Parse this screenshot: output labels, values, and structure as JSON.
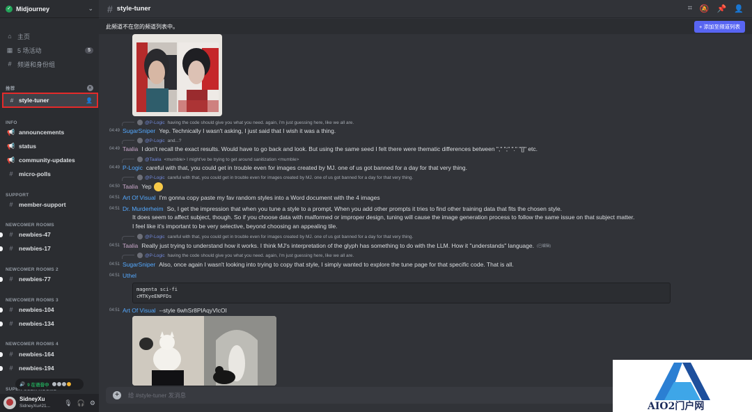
{
  "server": {
    "name": "Midjourney"
  },
  "nav": {
    "home": "主页",
    "events": "5 场活动",
    "events_count": "5",
    "channels_roles": "频道和身份组"
  },
  "recommended": {
    "header": "推荐",
    "channel": "style-tuner"
  },
  "categories": [
    {
      "name": "INFO",
      "channels": [
        "announcements",
        "status",
        "community-updates",
        "micro-polls"
      ]
    },
    {
      "name": "SUPPORT",
      "channels": [
        "member-support"
      ]
    },
    {
      "name": "NEWCOMER ROOMS",
      "channels": [
        "newbies-47",
        "newbies-17"
      ]
    },
    {
      "name": "NEWCOMER ROOMS 2",
      "channels": [
        "newbies-77"
      ]
    },
    {
      "name": "NEWCOMER ROOMS 3",
      "channels": [
        "newbies-104",
        "newbies-134"
      ]
    },
    {
      "name": "NEWCOMER ROOMS 4",
      "channels": [
        "newbies-164",
        "newbies-194"
      ]
    },
    {
      "name": "SUPER USER ROOMS",
      "channels": []
    }
  ],
  "voice": {
    "status": "9 在语音中"
  },
  "user": {
    "name": "SidneyXu",
    "tag": "SidneyXu#21..."
  },
  "channel": {
    "name": "style-tuner"
  },
  "notice": {
    "text": "此频道不在您的频道列表中。",
    "button": "+ 添加至频道列表"
  },
  "messages": [
    {
      "reply_author": "@P-Logic",
      "reply_text": "having the code should give you what you need. again, i'm just guessing here, like we all are.",
      "time": "04:49",
      "author": "SugarSniper",
      "text": "Yep. Technically I wasn't asking, I just said that I wish it was a thing."
    },
    {
      "reply_author": "@P-Logic",
      "reply_text": "and...?",
      "time": "04:49",
      "author": "Taalia",
      "text": "I don't recall the exact results. Would have to go back and look. But using the same seed I felt there were thematic differences between \",\" \";\" \".\" \"[]\" etc."
    },
    {
      "reply_author": "@Taalia",
      "reply_text": "<mumble> I might've be trying to get around sanitization <mumble>",
      "time": "04:49",
      "author": "P-Logic",
      "text": "careful with that, you could get in trouble even for images created by MJ. one of us got banned for a day for that very thing."
    },
    {
      "reply_author": "@P-Logic",
      "reply_text": "careful with that, you could get in trouble even for images created by MJ. one of us got banned for a day for that very thing.",
      "time": "04:50",
      "author": "Taalia",
      "text": "Yep"
    },
    {
      "time": "04:51",
      "author": "Art Of Visual",
      "text": "I'm gonna copy paste my fav random styles into a Word document with the 4 images"
    },
    {
      "time": "04:51",
      "author": "Dr. Murderheim",
      "text": "So, I get the impression that when you tune a style to a prompt, When you add other prompts it tries to find other training data that fits the chosen style.",
      "lines": [
        "It does seem to affect subject, though. So if you choose data with malformed or improper design, tuning will cause the image generation process to follow the same issue on that subject matter.",
        "I feel like it's important to be very selective, beyond choosing an appealing tile."
      ]
    },
    {
      "reply_author": "@P-Logic",
      "reply_text": "careful with that, you could get in trouble even for images created by MJ. one of us got banned for a day for that very thing.",
      "time": "04:51",
      "author": "Taalia",
      "text": "Really just trying to understand how it works. I think MJ's interpretation of the glyph has something to do with the LLM. How it \"understands\" language.",
      "edited": "(已编辑)"
    },
    {
      "reply_author": "@P-Logic",
      "reply_text": "having the code should give you what you need. again, i'm just guessing here, like we all are.",
      "time": "04:51",
      "author": "SugarSniper",
      "text": "Also, once again I wasn't looking into trying to copy that style, I simply wanted to explore the tune page for that specific code. That is all."
    },
    {
      "time": "04:51",
      "author": "Uthel",
      "code": [
        "magenta sci-fi",
        "cMTKyeENPFDs"
      ]
    },
    {
      "time": "04:51",
      "author": "Art Of Visual",
      "text": "--style 6whSr8PlAqyVlcOI"
    }
  ],
  "composer": {
    "placeholder": "给 #style-tuner 发消息"
  },
  "watermark": {
    "text": "AIO2门户网"
  }
}
